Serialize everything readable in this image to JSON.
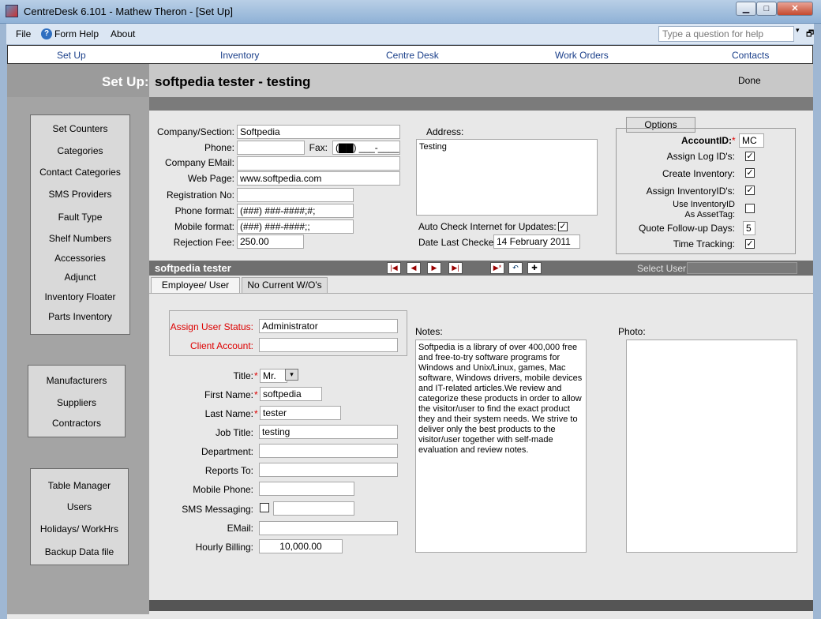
{
  "window": {
    "title": "CentreDesk 6.101 - Mathew Theron - [Set Up]",
    "min_label": "▁",
    "max_label": "□",
    "close_label": "✕"
  },
  "menu": {
    "file": "File",
    "form_help": "Form Help",
    "about": "About",
    "question_placeholder": "Type a question for help",
    "dropdown_arrow": "▾",
    "restore": "🗗"
  },
  "nav": [
    "Set Up",
    "Inventory",
    "Centre Desk",
    "Work Orders",
    "Contacts"
  ],
  "header": {
    "label": "Set Up:",
    "company_name": "softpedia tester - testing",
    "done": "Done"
  },
  "sidebar": {
    "group1": [
      "Set Counters",
      "Categories",
      "Contact Categories",
      "SMS Providers",
      "Fault Type",
      "Shelf Numbers",
      "Accessories",
      "Adjunct",
      "Inventory Floater",
      "Parts Inventory"
    ],
    "group2": [
      "Manufacturers",
      "Suppliers",
      "Contractors"
    ],
    "group3": [
      "Table Manager",
      "Users",
      "Holidays/ WorkHrs",
      "Backup Data file"
    ]
  },
  "company": {
    "section_label": "Company/Section:",
    "section_value": "Softpedia",
    "phone_label": "Phone:",
    "phone_value": "",
    "fax_label": "Fax:",
    "fax_value": "(▇▇) ___-____",
    "email_label": "Company EMail:",
    "email_value": "",
    "web_label": "Web Page:",
    "web_value": "www.softpedia.com",
    "reg_label": "Registration No:",
    "reg_value": "",
    "phone_format_label": "Phone format:",
    "phone_format_value": "(###) ###-####;#;",
    "mobile_format_label": "Mobile format:",
    "mobile_format_value": "(###) ###-####;;",
    "rejection_label": "Rejection Fee:",
    "rejection_value": "250.00",
    "address_label": "Address:",
    "address_value": "Testing",
    "auto_check_label": "Auto Check Internet for Updates:",
    "auto_check": true,
    "date_checked_label": "Date Last Checked:",
    "date_checked_value": "14 February 2011"
  },
  "options": {
    "title": "Options",
    "account_label": "AccountID:",
    "account_value": "MC",
    "assign_log_label": "Assign Log ID's:",
    "create_inventory_label": "Create Inventory:",
    "assign_inventory_label": "Assign InventoryID's:",
    "use_inventory_label_1": "Use InventoryID",
    "use_inventory_label_2": "As AssetTag:",
    "quote_days_label": "Quote Follow-up Days:",
    "quote_days_value": "5",
    "time_tracking_label": "Time Tracking:",
    "check_mark": "✓"
  },
  "employee_bar": {
    "name": "softpedia tester",
    "nav_first": "|◀",
    "nav_prev": "◀",
    "nav_next": "▶",
    "nav_last": "▶|",
    "nav_new": "▶*",
    "nav_undo": "↶",
    "nav_add": "✚",
    "select_user_label": "Select User:"
  },
  "tabs": [
    "Employee/ User",
    "No Current W/O's"
  ],
  "employee": {
    "status_label": "Assign User Status:",
    "status_value": "Administrator",
    "client_label": "Client Account:",
    "client_value": "",
    "title_label": "Title:",
    "title_value": "Mr.",
    "first_label": "First Name:",
    "first_value": "softpedia",
    "last_label": "Last Name:",
    "last_value": "tester",
    "job_label": "Job Title:",
    "job_value": "testing",
    "dept_label": "Department:",
    "dept_value": "",
    "reports_label": "Reports To:",
    "reports_value": "",
    "mobile_label": "Mobile Phone:",
    "mobile_value": "",
    "sms_label": "SMS Messaging:",
    "sms_value": "",
    "email_label": "EMail:",
    "email_value": "",
    "billing_label": "Hourly Billing:",
    "billing_value": "10,000.00",
    "notes_label": "Notes:",
    "notes_value": "Softpedia is a library of over 400,000 free and free-to-try software programs for Windows and Unix/Linux, games, Mac software, Windows drivers, mobile devices and IT-related articles.We review and categorize these products in order to allow the visitor/user to find the exact product they and their system needs. We strive to deliver only the best products to the visitor/user together with self-made evaluation and review notes.",
    "photo_label": "Photo:",
    "req_mark": "*"
  }
}
